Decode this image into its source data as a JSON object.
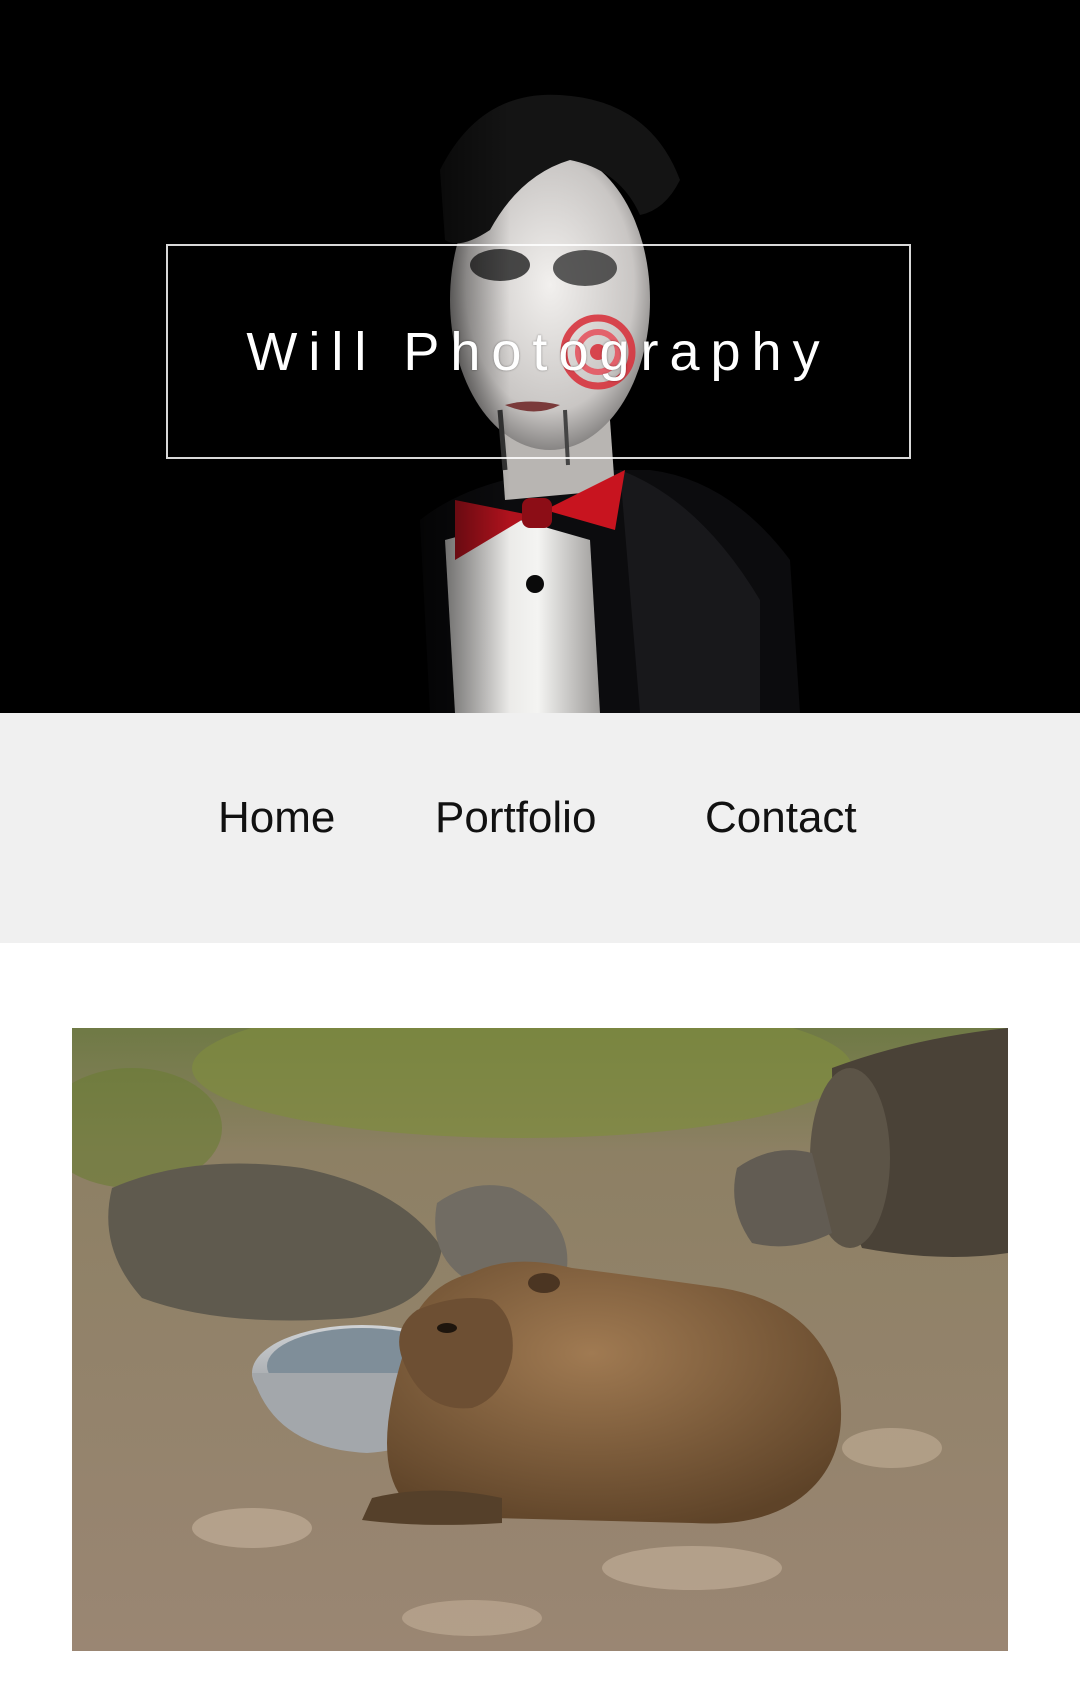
{
  "hero": {
    "title": "Will Photography"
  },
  "nav": {
    "items": [
      {
        "label": "Home"
      },
      {
        "label": "Portfolio"
      },
      {
        "label": "Contact"
      }
    ]
  },
  "colors": {
    "hero_background": "#000000",
    "nav_background": "#f0f0f0",
    "page_background": "#ffffff",
    "nav_text": "#111111",
    "title_text": "#ffffff"
  }
}
